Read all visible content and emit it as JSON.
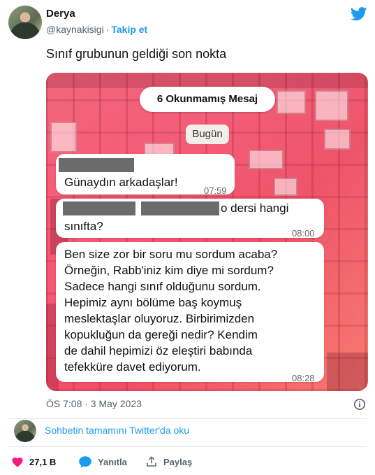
{
  "author": {
    "name": "Derya",
    "handle": "@kaynakisigi",
    "separator": "·",
    "follow_label": "Takip et"
  },
  "tweet": {
    "text": "Sınıf grubunun geldiği son nokta"
  },
  "media": {
    "unread_label": "6 Okunmamış Mesaj",
    "date_label": "Bugün",
    "messages": [
      {
        "text": "Günaydın arkadaşlar!",
        "time": "07:59"
      },
      {
        "text_fragment": "o dersi hangi",
        "text_line2": "sınıfta?",
        "time": "08:00"
      },
      {
        "lines": [
          "Ben size zor bir soru mu sordum acaba?",
          "Örneğin, Rabb'iniz kim diye mi sordum?",
          "Sadece hangi sınıf olduğunu sordum.",
          "Hepimiz aynı bölüme baş koymuş",
          "meslektaşlar oluyoruz. Birbirimizden",
          "kopukluğun da gereği nedir? Kendim",
          "de dahil hepimizi öz eleştiri babında",
          "tefekküre davet ediyorum."
        ],
        "time": "08:28"
      }
    ]
  },
  "footer": {
    "timestamp": "ÖS 7:08 · 3 May 2023",
    "thread_link": "Sohbetin tamamını Twitter'da oku",
    "actions": {
      "likes": "27,1 B",
      "reply": "Yanıtla",
      "share": "Paylaş"
    }
  },
  "colors": {
    "twitter_blue": "#1d9bf0",
    "like_red": "#f91880",
    "text_gray": "#536471"
  }
}
